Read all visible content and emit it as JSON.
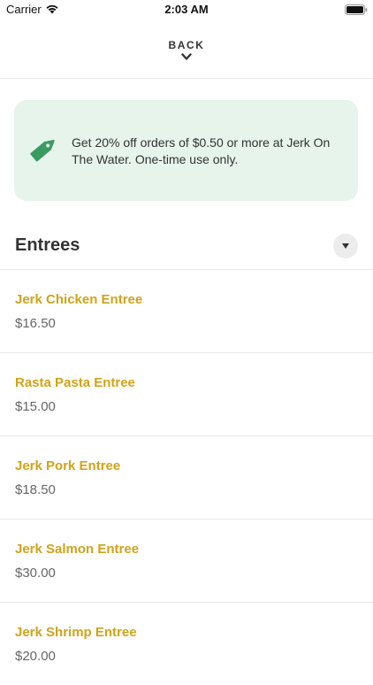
{
  "status_bar": {
    "carrier": "Carrier",
    "time": "2:03 AM",
    "icons": [
      "wifi-icon",
      "battery-icon"
    ]
  },
  "nav": {
    "back_label": "BACK",
    "icon": "chevron-down-icon"
  },
  "promo": {
    "icon": "tag-icon",
    "text": "Get 20% off orders of $0.50 or more at Jerk On The Water. One-time use only.",
    "background_color": "#e6f4ec",
    "icon_color": "#3a9b61"
  },
  "section": {
    "title": "Entrees",
    "toggle_icon": "caret-down-icon"
  },
  "menu_items": [
    {
      "name": "Jerk Chicken Entree",
      "price": "$16.50"
    },
    {
      "name": "Rasta Pasta Entree",
      "price": "$15.00"
    },
    {
      "name": "Jerk Pork Entree",
      "price": "$18.50"
    },
    {
      "name": "Jerk Salmon Entree",
      "price": "$30.00"
    },
    {
      "name": "Jerk Shrimp Entree",
      "price": "$20.00"
    }
  ],
  "colors": {
    "item_name": "#d0a319",
    "price": "#666666",
    "divider": "#e8e8e8"
  }
}
